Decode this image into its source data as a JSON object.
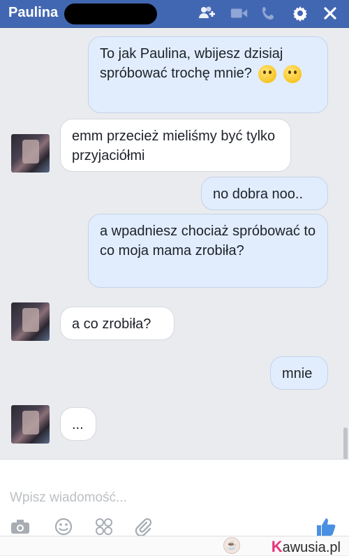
{
  "header": {
    "contact_name": "Paulina"
  },
  "messages": [
    {
      "side": "out",
      "text": "To jak Paulina, wbijesz dzisiaj spróbować trochę mnie?",
      "emojis": [
        "winking-face",
        "kissing-face"
      ]
    },
    {
      "side": "in",
      "text": "emm przecież mieliśmy być tylko przyjaciółmi"
    },
    {
      "side": "out",
      "text": "no dobra noo.."
    },
    {
      "side": "out",
      "text": "a wpadniesz chociaż spróbować to co moja mama zrobiła?"
    },
    {
      "side": "in",
      "text": "a co zrobiła?"
    },
    {
      "side": "out",
      "text": "mnie"
    },
    {
      "side": "in",
      "text": "..."
    }
  ],
  "composer": {
    "placeholder": "Wpisz wiadomość..."
  },
  "icons": {
    "header": [
      "add-people-icon",
      "video-call-icon",
      "phone-icon",
      "gear-icon",
      "close-icon"
    ],
    "composer": [
      "camera-icon",
      "emoji-icon",
      "stickers-icon",
      "attach-icon",
      "thumbs-up-icon"
    ]
  },
  "colors": {
    "header_bg": "#4267b2",
    "out_bubble": "#e1edfd",
    "in_bubble": "#ffffff",
    "brand_accent": "#e7337a"
  },
  "watermark": {
    "brand_text": "awusia.pl",
    "brand_initial": "K"
  }
}
